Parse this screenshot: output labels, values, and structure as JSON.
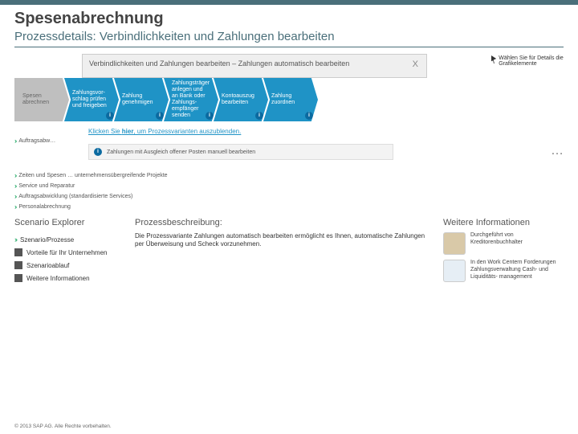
{
  "header": {
    "title": "Spesenabrechnung",
    "subtitle": "Prozessdetails: Verbindlichkeiten und Zahlungen bearbeiten"
  },
  "hint": "Wählen Sie für Details die Grafikelemente",
  "callout": {
    "title": "Verbindlichkeiten und Zahlungen bearbeiten – Zahlungen automatisch bearbeiten",
    "close": "X",
    "steps": [
      "Spesen abrechnen",
      "Zahlungsvor-\nschlag prüfen und freigeben",
      "Zahlung genehmigen",
      "Zahlungsträger anlegen und an Bank oder Zahlungs-\nempfänger senden",
      "Kontoauszug bearbeiten",
      "Zahlung zuordnen"
    ],
    "variant_link_prefix": "Klicken Sie ",
    "variant_link_here": "hier",
    "variant_link_suffix": ", um Prozessvarianten auszublenden.",
    "variant_item": "Zahlungen mit Ausgleich offener Posten manuell bearbeiten"
  },
  "mini_list": [
    "Auftragsabw…",
    "Zeiten und Spesen … unternehmensübergreifende Projekte",
    "Service und Reparatur",
    "Auftragsabwicklung (standardisierte Services)",
    "Personalabrechnung"
  ],
  "explorer": {
    "title": "Scenario Explorer",
    "nav": [
      {
        "icon": "chevs",
        "label": "Szenario/Prozesse"
      },
      {
        "icon": "box",
        "label": "Vorteile für Ihr Unternehmen"
      },
      {
        "icon": "box",
        "label": "Szenarioablauf"
      },
      {
        "icon": "box",
        "label": "Weitere Informationen"
      }
    ]
  },
  "process": {
    "title": "Prozessbeschreibung:",
    "text": "Die Prozessvariante Zahlungen automatisch bearbeiten ermöglicht es Ihnen, automatische Zahlungen per Überweisung und Scheck vorzunehmen."
  },
  "right": {
    "title": "Weitere Informationen",
    "role": "Durchgeführt von Kreditorenbuchhalter",
    "workcenters": "In den Work Centern Forderungen Zahlungsverwaltung Cash- und Liquiditäts-\nmanagement"
  },
  "footer": "© 2013 SAP AG. Alle Rechte vorbehalten."
}
